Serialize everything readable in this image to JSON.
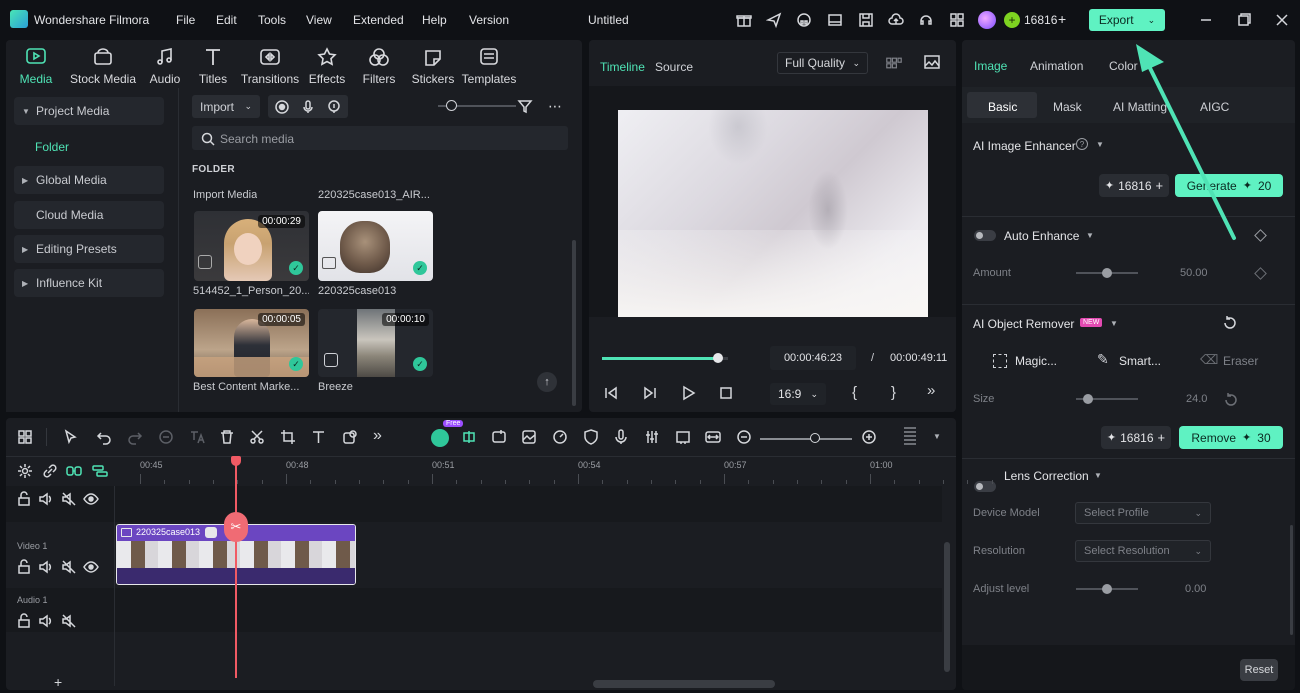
{
  "app": {
    "name": "Wondershare Filmora",
    "doc_title": "Untitled"
  },
  "menu": [
    "File",
    "Edit",
    "Tools",
    "View",
    "Extended",
    "Help",
    "Version"
  ],
  "account": {
    "credits": "16816",
    "plus": "+"
  },
  "export": {
    "label": "Export"
  },
  "media_tabs": [
    {
      "label": "Media",
      "icon": "media-icon"
    },
    {
      "label": "Stock Media",
      "icon": "stock-media-icon"
    },
    {
      "label": "Audio",
      "icon": "audio-icon"
    },
    {
      "label": "Titles",
      "icon": "titles-icon"
    },
    {
      "label": "Transitions",
      "icon": "transitions-icon"
    },
    {
      "label": "Effects",
      "icon": "effects-icon"
    },
    {
      "label": "Filters",
      "icon": "filters-icon"
    },
    {
      "label": "Stickers",
      "icon": "stickers-icon"
    },
    {
      "label": "Templates",
      "icon": "templates-icon"
    }
  ],
  "sidebar": {
    "project_media": "Project Media",
    "folder": "Folder",
    "items": [
      "Global Media",
      "Cloud Media",
      "Editing Presets",
      "Influence Kit"
    ]
  },
  "library": {
    "import_label": "Import",
    "search_placeholder": "Search media",
    "folder_header": "FOLDER",
    "import_media_label": "Import Media",
    "first_file_label": "220325case013_AIR...",
    "clips": [
      {
        "name": "514452_1_Person_20...",
        "duration": "00:00:29"
      },
      {
        "name": "220325case013",
        "duration": ""
      },
      {
        "name": "Best Content Marke...",
        "duration": "00:00:05"
      },
      {
        "name": "Breeze",
        "duration": "00:00:10"
      }
    ]
  },
  "preview": {
    "tab_timeline": "Timeline",
    "tab_source": "Source",
    "quality": "Full Quality",
    "current_time": "00:00:46:23",
    "separator": "/",
    "total_time": "00:00:49:11",
    "aspect": "16:9",
    "progress": 0.92
  },
  "inspector": {
    "tabs": [
      "Image",
      "Animation",
      "Color"
    ],
    "subtabs": [
      "Basic",
      "Mask",
      "AI Matting",
      "AIGC"
    ],
    "ai_enhancer": {
      "title": "AI Image Enhancer",
      "credits": "16816",
      "generate": "Generate",
      "cost": "20"
    },
    "auto_enhance": {
      "title": "Auto Enhance",
      "amount_label": "Amount",
      "amount_value": "50.00",
      "level": 0.5
    },
    "object_remover": {
      "title": "AI Object Remover",
      "badge": "NEW",
      "magic": "Magic...",
      "smart": "Smart...",
      "eraser": "Eraser",
      "size_label": "Size",
      "size_value": "24.0",
      "size_level": 0.2,
      "credits": "16816",
      "remove": "Remove",
      "cost": "30"
    },
    "lens": {
      "title": "Lens Correction",
      "device_label": "Device Model",
      "device_placeholder": "Select Profile",
      "resolution_label": "Resolution",
      "resolution_placeholder": "Select Resolution",
      "adjust_label": "Adjust level",
      "adjust_value": "0.00",
      "adjust_level": 0.5
    },
    "reset": "Reset"
  },
  "timeline": {
    "ruler": [
      "00:45",
      "00:48",
      "00:51",
      "00:54",
      "00:57",
      "01:00"
    ],
    "tracks": [
      {
        "label": ""
      },
      {
        "label": "Video 1"
      },
      {
        "label": "Audio 1"
      }
    ],
    "clip_name": "220325case013",
    "free_badge": "Free"
  },
  "colors": {
    "accent": "#4fe3b5",
    "export_bg": "#5ff2c2",
    "playhead": "#f05a64",
    "clip": "#6b46c1"
  }
}
